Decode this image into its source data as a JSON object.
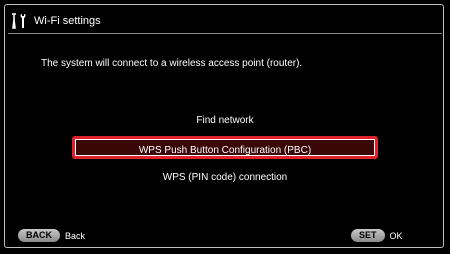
{
  "header": {
    "title": "Wi-Fi settings",
    "icon": "tools-icon"
  },
  "message": "The system will connect to a wireless access point (router).",
  "options": [
    {
      "label": "Find network"
    },
    {
      "label": "WPS Push Button Configuration (PBC)",
      "selected": true
    },
    {
      "label": "WPS (PIN code) connection"
    }
  ],
  "footer": {
    "back_key": "BACK",
    "back_label": "Back",
    "set_key": "SET",
    "set_label": "OK"
  },
  "colors": {
    "selection_border": "#e0202a",
    "background": "#000000"
  }
}
